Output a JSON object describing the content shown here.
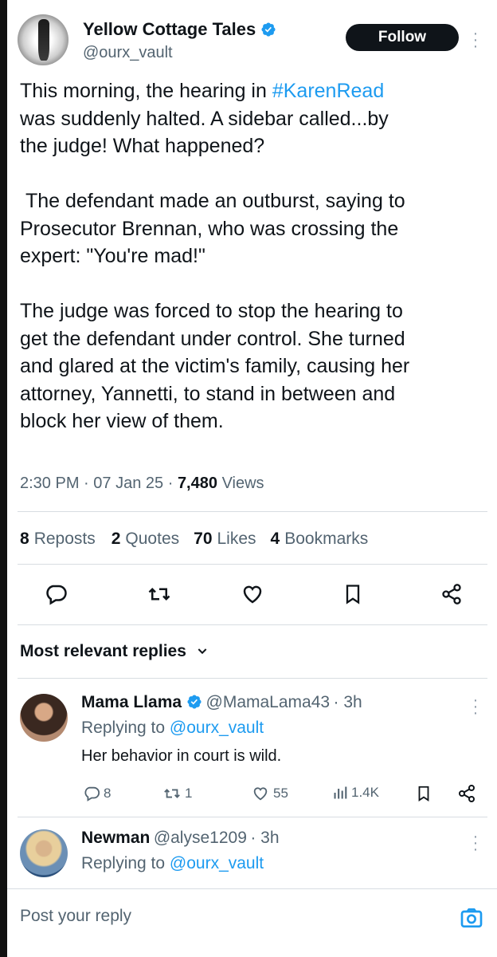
{
  "author": {
    "display_name": "Yellow Cottage Tales",
    "handle": "@ourx_vault",
    "follow_label": "Follow"
  },
  "tweet": {
    "text_before_tag": "This morning, the hearing in ",
    "hashtag": "#KarenRead",
    "text_after_tag": "\nwas suddenly halted. A sidebar called...by\nthe judge! What happened?\n\n The defendant made an outburst, saying to\nProsecutor Brennan, who was crossing the\nexpert: \"You're mad!\"\n\nThe judge was forced to stop the hearing to\nget the defendant under control. She turned\nand glared at the victim's family, causing her\nattorney, Yannetti, to stand in between and\nblock her view of them.",
    "time": "2:30 PM",
    "date": "07 Jan 25",
    "views_count": "7,480",
    "views_label": "Views",
    "sep": "·"
  },
  "stats": {
    "reposts_count": "8",
    "reposts_label": "Reposts",
    "quotes_count": "2",
    "quotes_label": "Quotes",
    "likes_count": "70",
    "likes_label": "Likes",
    "bookmarks_count": "4",
    "bookmarks_label": "Bookmarks"
  },
  "replies_header": "Most relevant replies",
  "replies": [
    {
      "name": "Mama Llama",
      "handle": "@MamaLama43",
      "time": "· 3h",
      "replying_prefix": "Replying to ",
      "replying_handle": "@ourx_vault",
      "text": "Her behavior in court is wild.",
      "replies_count": "8",
      "reposts_count": "1",
      "likes_count": "55",
      "views_count": "1.4K"
    },
    {
      "name": "Newman",
      "handle": "@alyse1209",
      "time": "· 3h",
      "replying_prefix": "Replying to ",
      "replying_handle": "@ourx_vault"
    }
  ],
  "compose": {
    "placeholder": "Post your reply"
  },
  "icons": [
    "verified-badge-icon",
    "more-icon",
    "reply-icon",
    "repost-icon",
    "like-icon",
    "bookmark-icon",
    "share-icon",
    "chevron-down-icon",
    "views-icon",
    "camera-icon"
  ],
  "colors": {
    "accent": "#1d9bf0",
    "text": "#0f1419",
    "muted": "#536471",
    "button": "#0f1419"
  }
}
